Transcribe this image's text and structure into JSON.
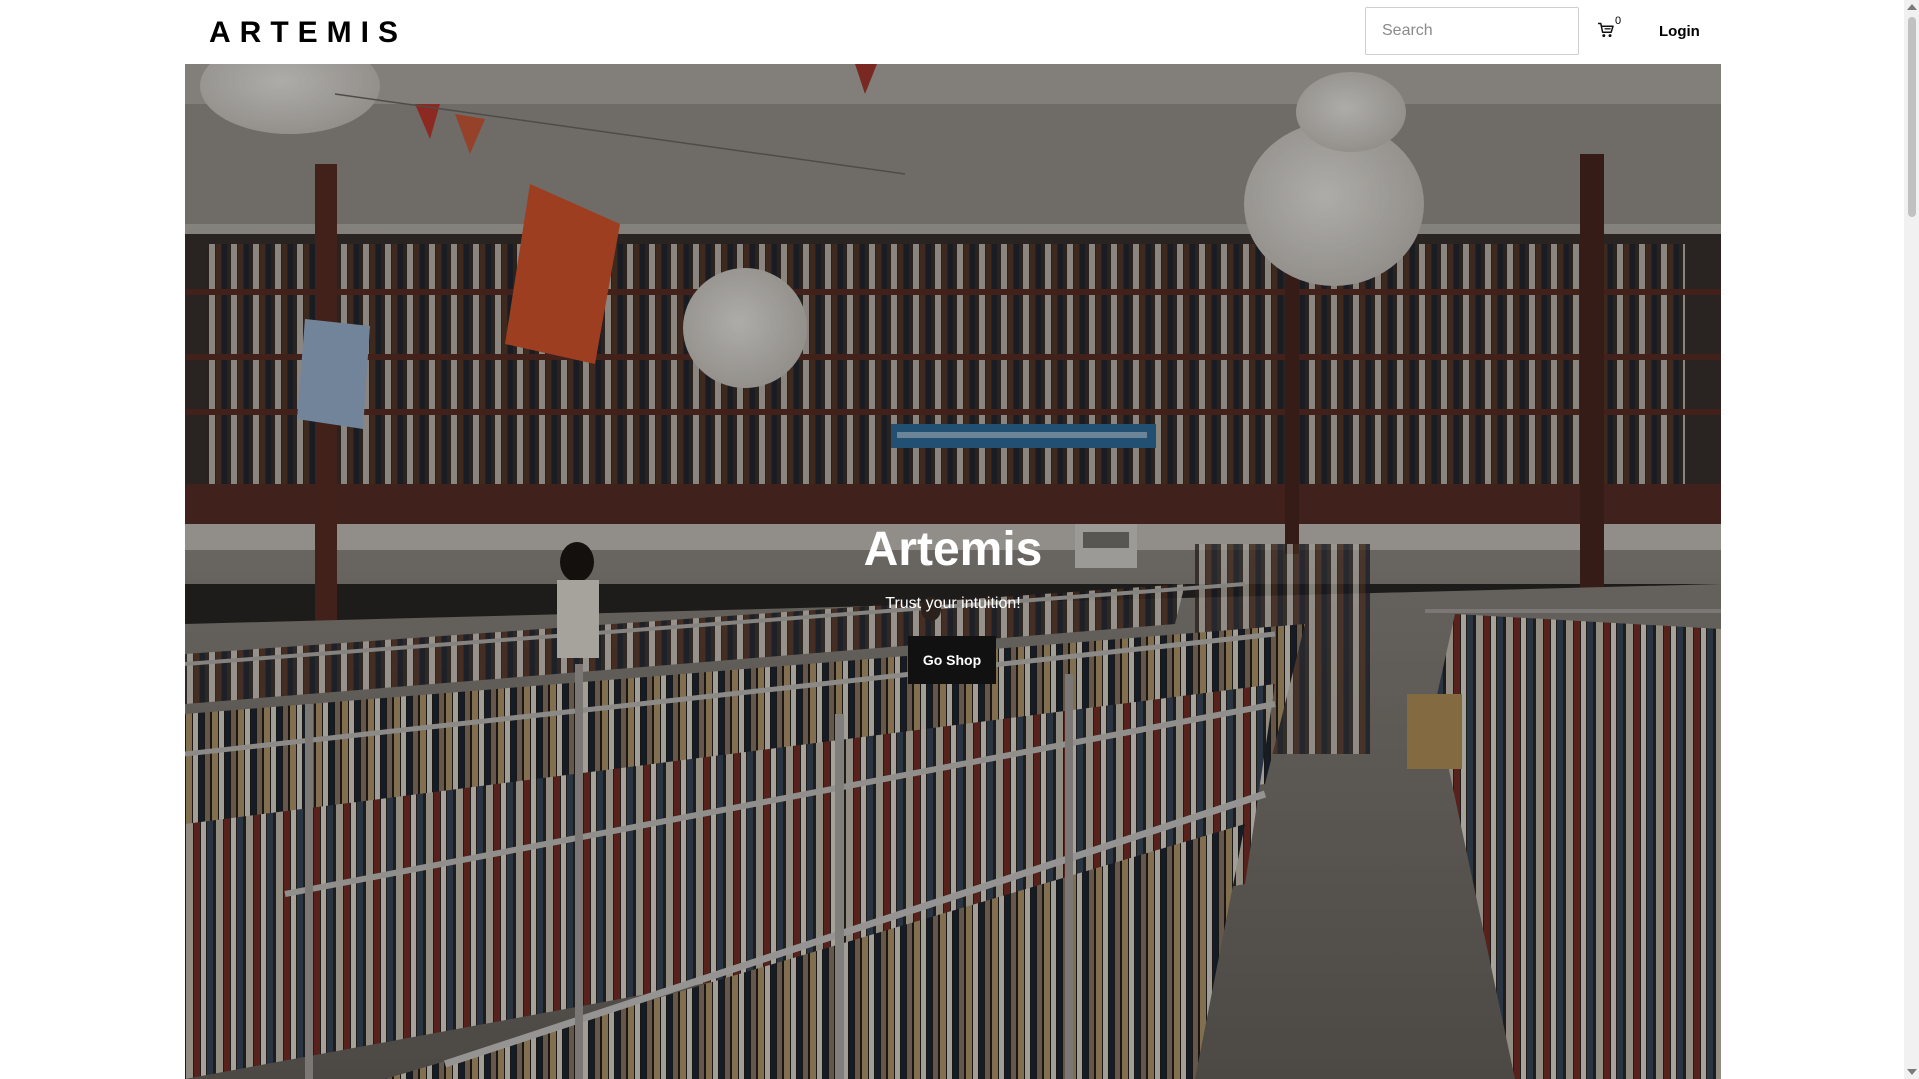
{
  "header": {
    "brand": "ARTEMIS",
    "search_placeholder": "Search",
    "search_value": "",
    "cart_count": "0",
    "login_label": "Login"
  },
  "hero": {
    "title": "Artemis",
    "subtitle": "Trust your intuition!",
    "button_label": "Go Shop",
    "overlay_color": "#000000",
    "button_color": "#111111"
  },
  "icons": {
    "cart": "shopping-cart-icon"
  }
}
